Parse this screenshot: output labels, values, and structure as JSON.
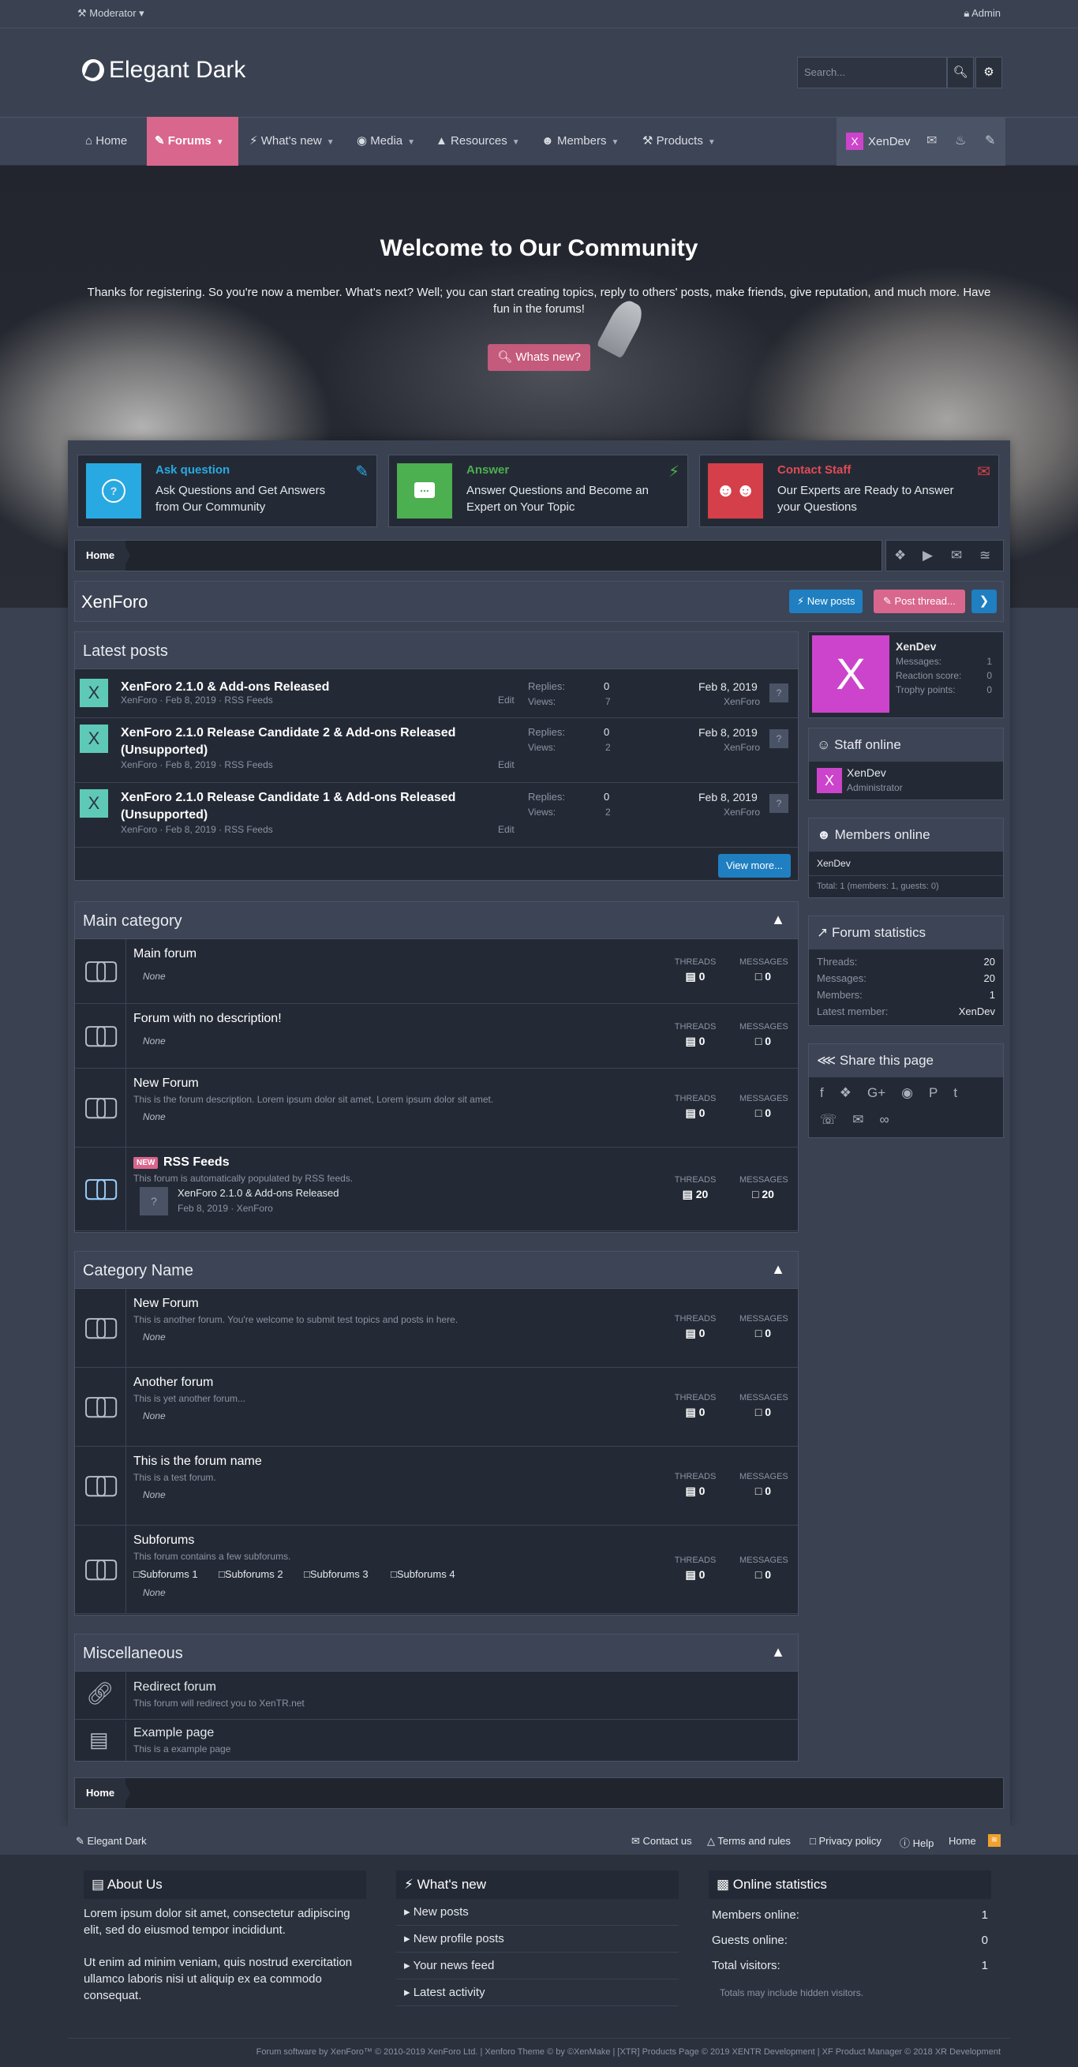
{
  "topbar": {
    "moderator": "Moderator",
    "admin": "Admin"
  },
  "logo": {
    "text": "Elegant Dark"
  },
  "search": {
    "placeholder": "Search..."
  },
  "nav": {
    "items": [
      {
        "label": "Home"
      },
      {
        "label": "Forums"
      },
      {
        "label": "What's new"
      },
      {
        "label": "Media"
      },
      {
        "label": "Resources"
      },
      {
        "label": "Members"
      },
      {
        "label": "Products"
      }
    ],
    "user": "XenDev",
    "avatar_letter": "X"
  },
  "hero": {
    "title": "Welcome to Our Community",
    "text": "Thanks for registering. So you're now a member. What's next? Well; you can start creating topics, reply to others' posts, make friends, give reputation, and much more. Have fun in the forums!",
    "button": "Whats new?"
  },
  "features": [
    {
      "title": "Ask question",
      "text": "Ask Questions and Get Answers from Our Community",
      "color": "#29a9e1",
      "icon": "question-icon"
    },
    {
      "title": "Answer",
      "text": "Answer Questions and Become an Expert on Your Topic",
      "color": "#4caf50",
      "icon": "chat-icon"
    },
    {
      "title": "Contact Staff",
      "text": "Our Experts are Ready to Answer your Questions",
      "color": "#d43f4a",
      "icon": "users-icon"
    }
  ],
  "breadcrumb": {
    "home": "Home"
  },
  "page": {
    "title": "XenForo",
    "new_posts": "New posts",
    "post_thread": "Post thread..."
  },
  "latest": {
    "title": "Latest posts",
    "replies_label": "Replies:",
    "views_label": "Views:",
    "edit": "Edit",
    "view_more": "View more...",
    "posts": [
      {
        "title": "XenForo 2.1.0 & Add-ons Released",
        "meta": "XenForo · Feb 8, 2019 · RSS Feeds",
        "replies": "0",
        "views": "7",
        "date": "Feb 8, 2019",
        "by": "XenForo"
      },
      {
        "title": "XenForo 2.1.0 Release Candidate 2 & Add-ons Released (Unsupported)",
        "meta": "XenForo · Feb 8, 2019 · RSS Feeds",
        "replies": "0",
        "views": "2",
        "date": "Feb 8, 2019",
        "by": "XenForo"
      },
      {
        "title": "XenForo 2.1.0 Release Candidate 1 & Add-ons Released (Unsupported)",
        "meta": "XenForo · Feb 8, 2019 · RSS Feeds",
        "replies": "0",
        "views": "2",
        "date": "Feb 8, 2019",
        "by": "XenForo"
      }
    ]
  },
  "labels": {
    "threads": "THREADS",
    "messages": "MESSAGES",
    "none": "None"
  },
  "main_category": {
    "title": "Main category",
    "forums": [
      {
        "name": "Main forum",
        "desc": "",
        "threads": "0",
        "messages": "0"
      },
      {
        "name": "Forum with no description!",
        "desc": "",
        "threads": "0",
        "messages": "0"
      },
      {
        "name": "New Forum",
        "desc": "This is the forum description. Lorem ipsum dolor sit amet, Lorem ipsum dolor sit amet.",
        "threads": "0",
        "messages": "0"
      }
    ],
    "rss": {
      "badge": "NEW",
      "name": "RSS Feeds",
      "desc": "This forum is automatically populated by RSS feeds.",
      "last_title": "XenForo 2.1.0 & Add-ons Released",
      "last_meta": "Feb 8, 2019 · XenForo",
      "threads": "20",
      "messages": "20"
    }
  },
  "category_name": {
    "title": "Category Name",
    "forums": [
      {
        "name": "New Forum",
        "desc": "This is another forum. You're welcome to submit test topics and posts in here.",
        "threads": "0",
        "messages": "0"
      },
      {
        "name": "Another forum",
        "desc": "This is yet another forum...",
        "threads": "0",
        "messages": "0"
      },
      {
        "name": "This is the forum name",
        "desc": "This is a test forum.",
        "threads": "0",
        "messages": "0"
      },
      {
        "name": "Subforums",
        "desc": "This forum contains a few subforums.",
        "threads": "0",
        "messages": "0"
      }
    ],
    "subforums": [
      "Subforums 1",
      "Subforums 2",
      "Subforums 3",
      "Subforums 4"
    ]
  },
  "misc": {
    "title": "Miscellaneous",
    "items": [
      {
        "name": "Redirect forum",
        "desc": "This forum will redirect you to XenTR.net"
      },
      {
        "name": "Example page",
        "desc": "This is a example page"
      }
    ]
  },
  "sidebar": {
    "user": {
      "name": "XenDev",
      "letter": "X",
      "messages_label": "Messages:",
      "messages": "1",
      "reaction_label": "Reaction score:",
      "reaction": "0",
      "trophy_label": "Trophy points:",
      "trophy": "0"
    },
    "staff": {
      "title": "Staff online",
      "name": "XenDev",
      "role": "Administrator",
      "letter": "X"
    },
    "members": {
      "title": "Members online",
      "name": "XenDev",
      "total": "Total: 1 (members: 1, guests: 0)"
    },
    "stats": {
      "title": "Forum statistics",
      "threads_label": "Threads:",
      "threads": "20",
      "messages_label": "Messages:",
      "messages": "20",
      "members_label": "Members:",
      "members": "1",
      "latest_label": "Latest member:",
      "latest": "XenDev"
    },
    "share": {
      "title": "Share this page"
    }
  },
  "footer": {
    "style": "Elegant Dark",
    "links": [
      "Contact us",
      "Terms and rules",
      "Privacy policy",
      "Help",
      "Home"
    ],
    "about": {
      "title": "About Us",
      "p1": "Lorem ipsum dolor sit amet, consectetur adipiscing elit, sed do eiusmod tempor incididunt.",
      "p2": "Ut enim ad minim veniam, quis nostrud exercitation ullamco laboris nisi ut aliquip ex ea commodo consequat."
    },
    "whatsnew": {
      "title": "What's new",
      "items": [
        "New posts",
        "New profile posts",
        "Your news feed",
        "Latest activity"
      ]
    },
    "online": {
      "title": "Online statistics",
      "members_label": "Members online:",
      "members": "1",
      "guests_label": "Guests online:",
      "guests": "0",
      "total_label": "Total visitors:",
      "total": "1",
      "note": "Totals may include hidden visitors."
    },
    "copyright": "Forum software by XenForo™ © 2010-2019 XenForo Ltd. | Xenforo Theme © by ©XenMake | [XTR] Products Page © 2019 XENTR Development | XF Product Manager © 2018 XR Development"
  }
}
